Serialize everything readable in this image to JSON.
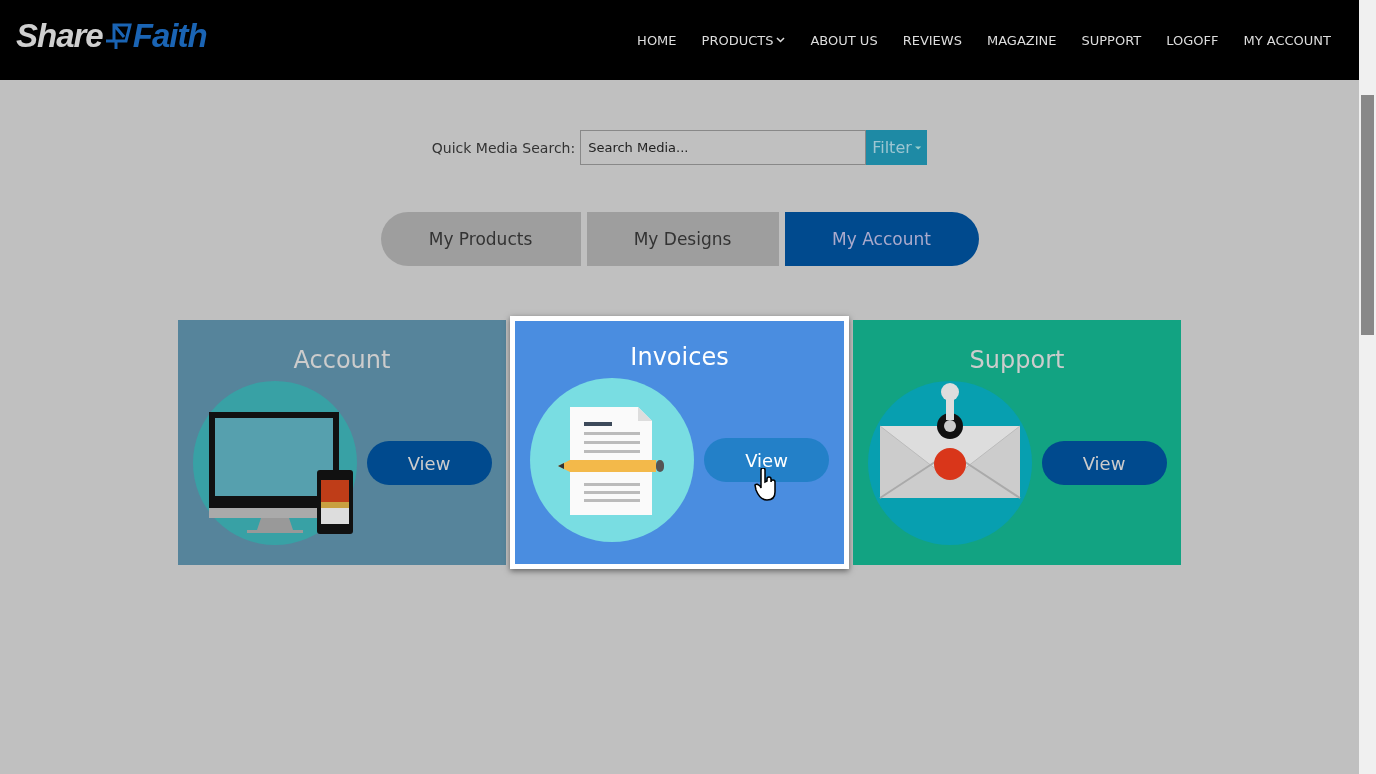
{
  "logo": {
    "left": "Share",
    "right": "Faith"
  },
  "nav": [
    {
      "label": "HOME",
      "dropdown": false
    },
    {
      "label": "PRODUCTS",
      "dropdown": true
    },
    {
      "label": "ABOUT US",
      "dropdown": false
    },
    {
      "label": "REVIEWS",
      "dropdown": false
    },
    {
      "label": "MAGAZINE",
      "dropdown": false
    },
    {
      "label": "SUPPORT",
      "dropdown": false
    },
    {
      "label": "LOGOFF",
      "dropdown": false
    },
    {
      "label": "MY ACCOUNT",
      "dropdown": false
    }
  ],
  "search": {
    "label": "Quick Media Search:",
    "placeholder": "Search Media...",
    "button": "Filter"
  },
  "tabs": [
    {
      "label": "My Products",
      "selected": false
    },
    {
      "label": "My Designs",
      "selected": false
    },
    {
      "label": "My Account",
      "selected": true
    }
  ],
  "cards": [
    {
      "title": "Account",
      "kind": "devices",
      "color": "#56849b",
      "selected": false,
      "button": "View"
    },
    {
      "title": "Invoices",
      "kind": "document",
      "color": "#4a8de0",
      "selected": true,
      "button": "View"
    },
    {
      "title": "Support",
      "kind": "mail",
      "color": "#12a382",
      "selected": false,
      "button": "View"
    }
  ]
}
